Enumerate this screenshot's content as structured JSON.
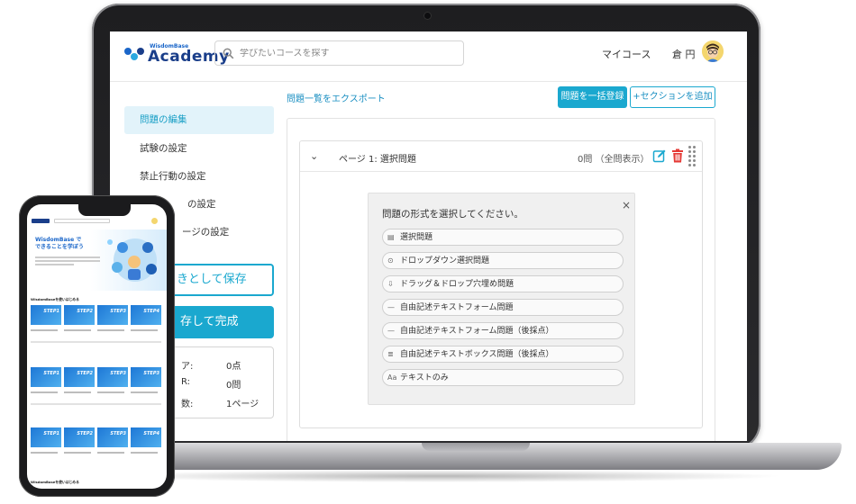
{
  "header": {
    "logo_small": "WisdomBase",
    "logo_big": "Academy",
    "search_placeholder": "学びたいコースを探す",
    "my_course": "マイコース",
    "user_name": "倉 円"
  },
  "sidebar": {
    "items": [
      {
        "label": "問題の編集",
        "active": true
      },
      {
        "label": "試験の設定",
        "active": false
      },
      {
        "label": "禁止行動の設定",
        "active": false
      },
      {
        "label": "の設定",
        "active": false
      },
      {
        "label": "ージの設定",
        "active": false
      }
    ],
    "draft_button": "きとして保存",
    "complete_button": "存して完成",
    "stats": [
      {
        "key": "ア:",
        "value": "0点"
      },
      {
        "key": "R:",
        "value": "0問"
      },
      {
        "key": "数:",
        "value": "1ページ"
      }
    ]
  },
  "main": {
    "export_link": "問題一覧をエクスポート",
    "bulk_register": "問題を一括登録",
    "add_section": "+セクションを追加",
    "page_title": "ページ 1: 選択問題",
    "page_count": "0問 （全問表示）"
  },
  "popup": {
    "title": "問題の形式を選択してください。",
    "close": "×",
    "options": [
      {
        "icon": "list-icon",
        "glyph": "▤",
        "label": "選択問題"
      },
      {
        "icon": "dropdown-icon",
        "glyph": "⊙",
        "label": "ドロップダウン選択問題"
      },
      {
        "icon": "drag-drop-icon",
        "glyph": "⇩",
        "label": "ドラッグ＆ドロップ穴埋め問題"
      },
      {
        "icon": "text-line-icon",
        "glyph": "—",
        "label": "自由記述テキストフォーム問題"
      },
      {
        "icon": "text-line-icon",
        "glyph": "—",
        "label": "自由記述テキストフォーム問題（後採点）"
      },
      {
        "icon": "text-box-icon",
        "glyph": "≣",
        "label": "自由記述テキストボックス問題（後採点）"
      },
      {
        "icon": "text-only-icon",
        "glyph": "Aa",
        "label": "テキストのみ"
      }
    ]
  },
  "phone": {
    "hero_title_1": "WisdomBase で",
    "hero_title_2": "できることを学ぼう",
    "section_1": "WisdomBaseを使いはじめる",
    "section_3": "WisdomBaseを使いはじめる",
    "steps": [
      "STEP1",
      "STEP2",
      "STEP3",
      "STEP4"
    ]
  },
  "colors": {
    "accent": "#1aa8cf",
    "link": "#1a8fc2",
    "brand": "#1a3e8a",
    "delete": "#e53935"
  }
}
